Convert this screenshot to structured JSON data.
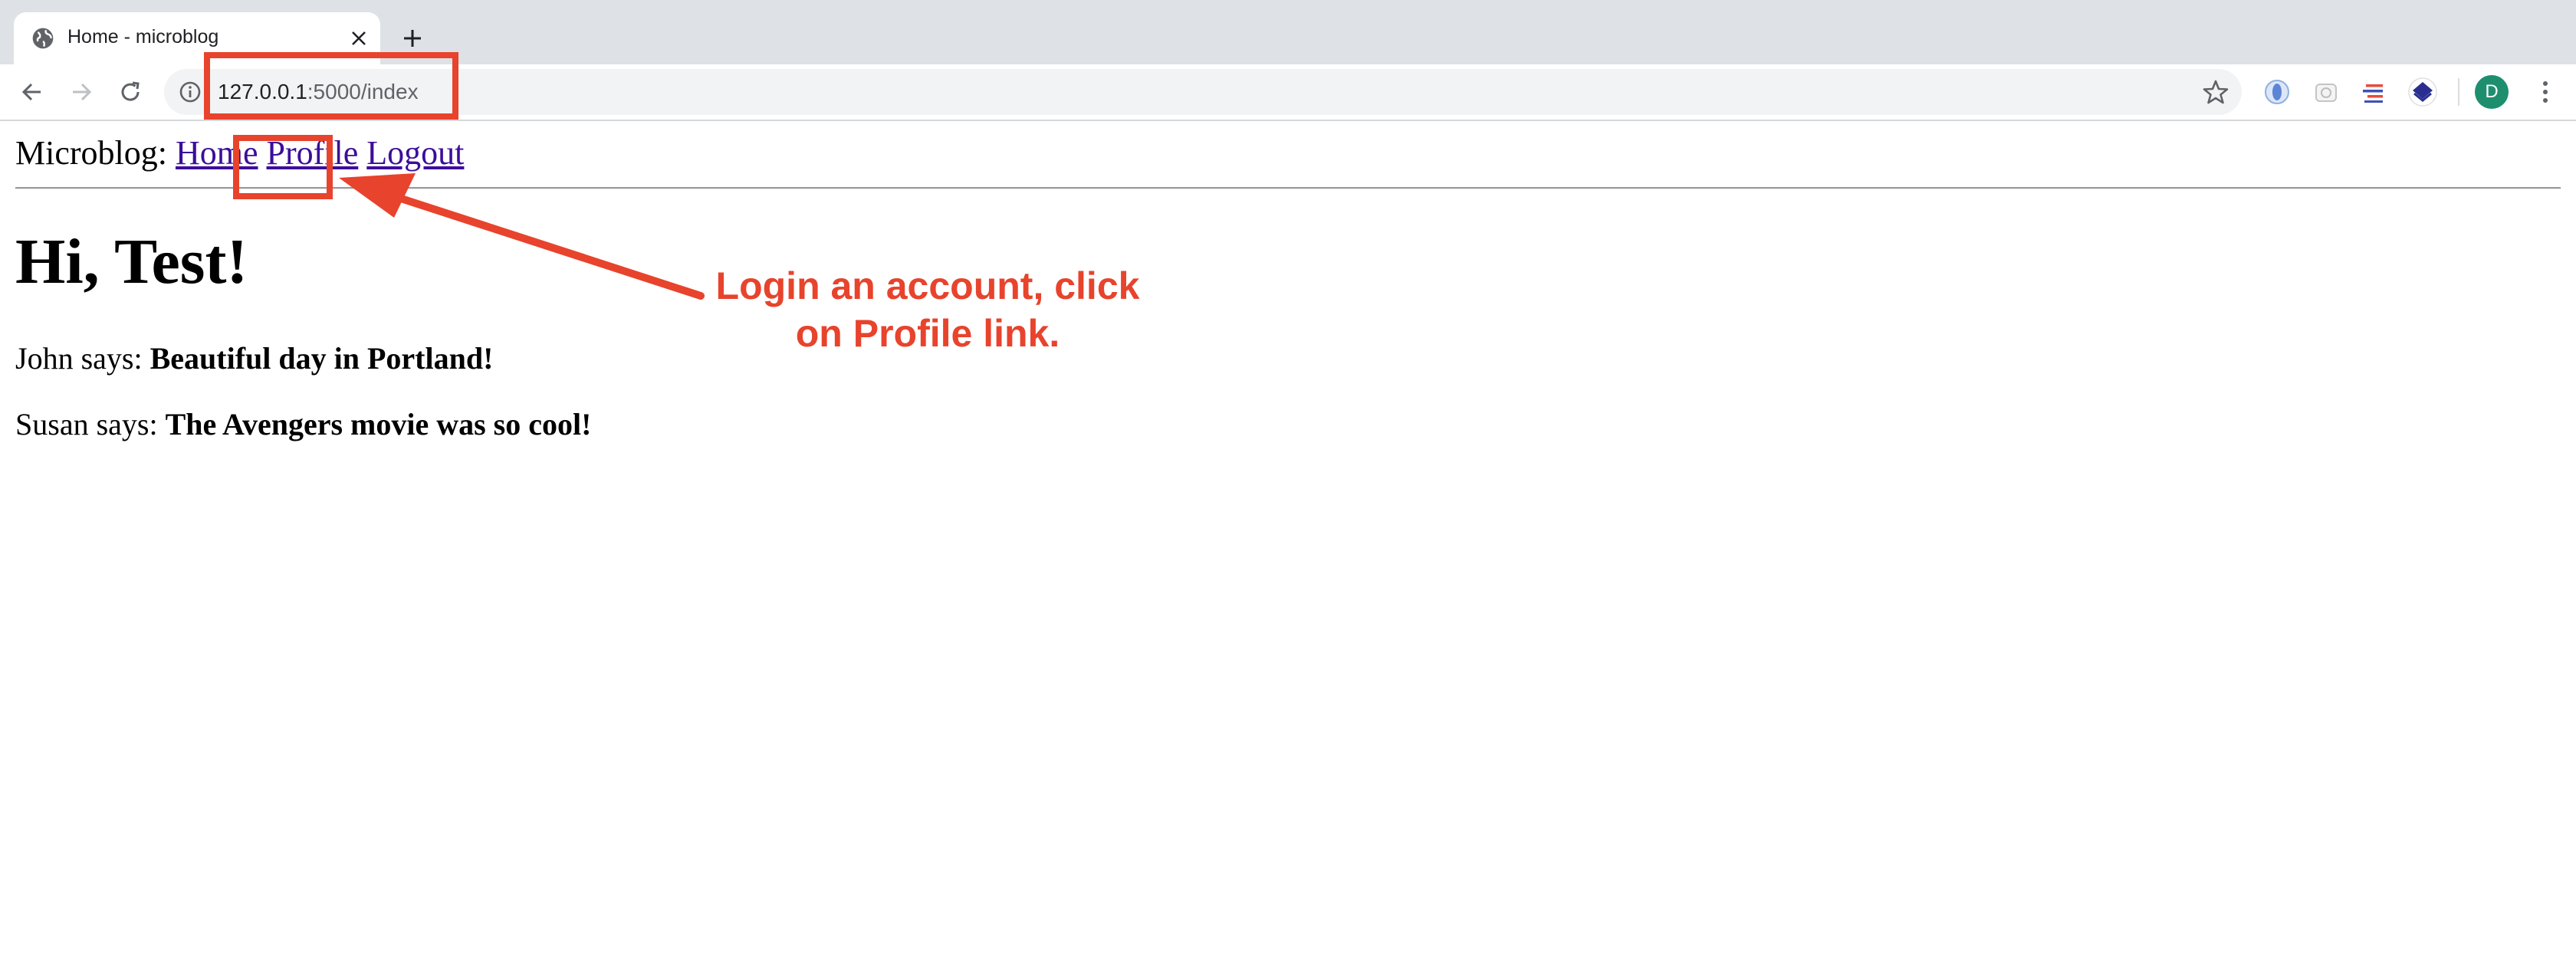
{
  "browser": {
    "tab": {
      "title": "Home - microblog",
      "favicon": "globe-icon",
      "close_icon": "close-icon"
    },
    "new_tab_icon": "plus-icon",
    "url_host": "127.0.0.1",
    "url_rest": ":5000/index",
    "avatar_letter": "D",
    "icons": [
      "back-arrow-icon",
      "forward-arrow-icon",
      "reload-icon",
      "info-icon",
      "star-icon",
      "menu-dots-icon"
    ],
    "extensions": [
      "onepassword-icon",
      "camera-extension-icon",
      "list-extension-icon",
      "layers-extension-icon"
    ]
  },
  "page": {
    "brand": "Microblog:",
    "nav": {
      "home": "Home",
      "profile": "Profile",
      "logout": "Logout"
    },
    "greeting": "Hi, Test!",
    "posts": [
      {
        "author_prefix": "John says:",
        "body": "Beautiful day in Portland!"
      },
      {
        "author_prefix": "Susan says:",
        "body": "The Avengers movie was so cool!"
      }
    ]
  },
  "annotation": {
    "line1": "Login an account, click",
    "line2": "on Profile link.",
    "color": "#e8432c"
  },
  "colors": {
    "link": "#3b0e9a",
    "tabstrip": "#dee1e6",
    "omnibox": "#f1f3f4",
    "avatar": "#1e8f6e"
  }
}
